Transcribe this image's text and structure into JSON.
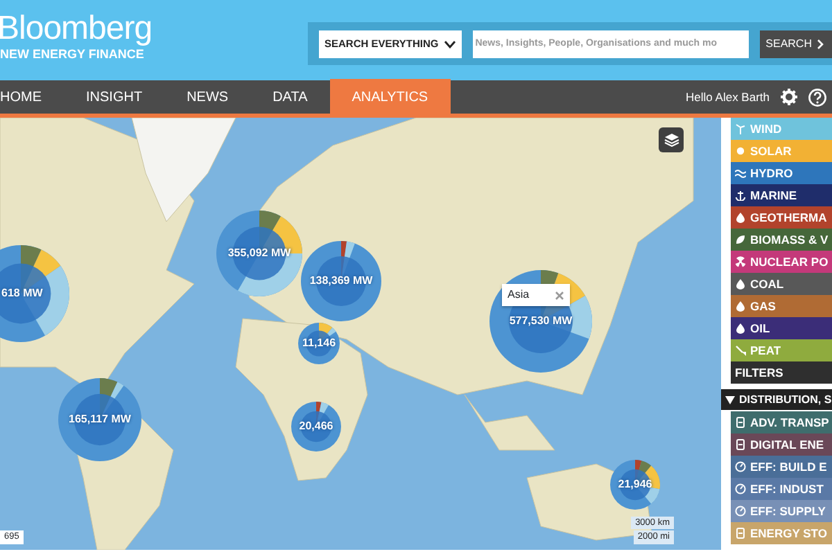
{
  "header": {
    "logo_title": "Bloomberg",
    "logo_subtitle": "NEW ENERGY FINANCE",
    "search": {
      "scope": "SEARCH EVERYTHING",
      "placeholder": "News, Insights, People, Organisations and much mo",
      "button": "SEARCH"
    }
  },
  "nav": {
    "tabs": [
      {
        "label": "HOME",
        "selected": false
      },
      {
        "label": "INSIGHT",
        "selected": false
      },
      {
        "label": "NEWS",
        "selected": false
      },
      {
        "label": "DATA",
        "selected": false
      },
      {
        "label": "ANALYTICS",
        "selected": true
      }
    ],
    "greeting": "Hello Alex Barth"
  },
  "map": {
    "markers": [
      {
        "label": "618 MW"
      },
      {
        "label": "355,092 MW"
      },
      {
        "label": "138,369 MW"
      },
      {
        "label": "11,146"
      },
      {
        "label": "165,117 MW"
      },
      {
        "label": "20,466"
      },
      {
        "label": "577,530 MW"
      },
      {
        "label": "21,946"
      }
    ],
    "popup": {
      "title": "Asia"
    },
    "scale": [
      "3000 km",
      "2000 mi"
    ],
    "attribution": "695"
  },
  "sidebar": {
    "technologies": [
      {
        "label": "WIND",
        "color": "#6fc3dc"
      },
      {
        "label": "SOLAR",
        "color": "#f2b134"
      },
      {
        "label": "HYDRO",
        "color": "#2e76bb"
      },
      {
        "label": "MARINE",
        "color": "#1f2d6b"
      },
      {
        "label": "GEOTHERMA",
        "color": "#b2432c"
      },
      {
        "label": "BIOMASS & V",
        "color": "#46673a"
      },
      {
        "label": "NUCLEAR PO",
        "color": "#c4397a"
      },
      {
        "label": "COAL",
        "color": "#585858"
      },
      {
        "label": "GAS",
        "color": "#b06b34"
      },
      {
        "label": "OIL",
        "color": "#3b2d78"
      },
      {
        "label": "PEAT",
        "color": "#8fab3e"
      }
    ],
    "filters_label": "FILTERS",
    "section": {
      "label": "DISTRIBUTION, S",
      "expanded": true
    },
    "items": [
      {
        "label": "ADV. TRANSP",
        "color": "#3f6d6d"
      },
      {
        "label": "DIGITAL ENE",
        "color": "#6a4858"
      },
      {
        "label": "EFF: BUILD E",
        "color": "#4a6e98"
      },
      {
        "label": "EFF: INDUST",
        "color": "#5a79a6"
      },
      {
        "label": "EFF: SUPPLY",
        "color": "#7890b6"
      },
      {
        "label": "ENERGY STO",
        "color": "#c8a56a"
      }
    ]
  }
}
